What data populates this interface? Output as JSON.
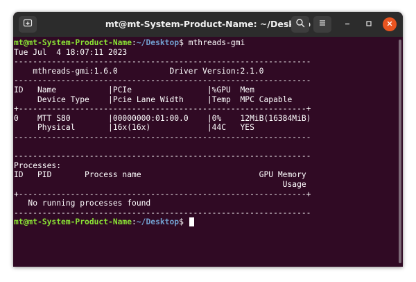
{
  "window": {
    "title": "mt@mt-System-Product-Name: ~/Desktop",
    "buttons": {
      "new_tab_icon": "new-tab-icon",
      "search_icon": "search-icon",
      "menu_icon": "hamburger-menu-icon",
      "minimize_icon": "minimize-icon",
      "maximize_icon": "maximize-icon",
      "close_icon": "close-icon"
    }
  },
  "colors": {
    "terminal_bg": "#300a24",
    "titlebar_bg": "#2c2c2c",
    "prompt_user": "#8ae234",
    "prompt_path": "#729fcf",
    "close_button": "#e95420"
  },
  "terminal": {
    "prompt": {
      "user_host": "mt@mt-System-Product-Name",
      "colon": ":",
      "path": "~/Desktop",
      "dollar": "$ "
    },
    "command": "mthreads-gmi",
    "lines": [
      "Tue Jul  4 18:07:11 2023",
      "---------------------------------------------------------------",
      "    mthreads-gmi:1.6.0           Driver Version:2.1.0",
      "---------------------------------------------------------------",
      "ID   Name           |PCIe                |%GPU  Mem",
      "     Device Type    |Pcie Lane Width     |Temp  MPC Capable",
      "+-------------------------------------------------------------+",
      "0    MTT S80        |00000000:01:00.0    |0%    12MiB(16384MiB)",
      "     Physical       |16x(16x)            |44C   YES",
      "---------------------------------------------------------------",
      "",
      "---------------------------------------------------------------",
      "Processes:",
      "ID   PID       Process name                         GPU Memory",
      "                                                         Usage",
      "+-------------------------------------------------------------+",
      "   No running processes found",
      "---------------------------------------------------------------"
    ]
  }
}
